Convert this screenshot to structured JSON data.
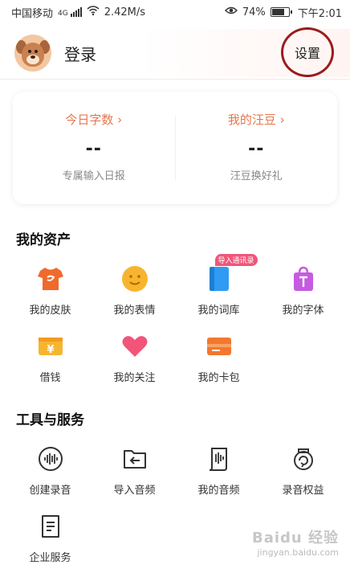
{
  "status_bar": {
    "carrier": "中国移动",
    "network": "4G",
    "speed": "2.42M/s",
    "battery": "74%",
    "time": "下午2:01"
  },
  "header": {
    "login": "登录",
    "settings": "设置"
  },
  "stats": [
    {
      "title": "今日字数 ›",
      "value": "--",
      "sub": "专属输入日报"
    },
    {
      "title": "我的汪豆 ›",
      "value": "--",
      "sub": "汪豆换好礼"
    }
  ],
  "assets": {
    "title": "我的资产",
    "items": [
      {
        "label": "我的皮肤",
        "icon": "shirt-icon"
      },
      {
        "label": "我的表情",
        "icon": "smiley-icon"
      },
      {
        "label": "我的词库",
        "icon": "book-icon",
        "badge": "导入通讯录"
      },
      {
        "label": "我的字体",
        "icon": "font-bag-icon"
      },
      {
        "label": "借钱",
        "icon": "yen-icon"
      },
      {
        "label": "我的关注",
        "icon": "heart-icon"
      },
      {
        "label": "我的卡包",
        "icon": "card-icon"
      }
    ]
  },
  "tools": {
    "title": "工具与服务",
    "items": [
      {
        "label": "创建录音",
        "icon": "waveform-icon"
      },
      {
        "label": "导入音频",
        "icon": "import-folder-icon"
      },
      {
        "label": "我的音频",
        "icon": "audio-document-icon"
      },
      {
        "label": "录音权益",
        "icon": "recording-rights-icon"
      },
      {
        "label": "企业服务",
        "icon": "enterprise-document-icon"
      }
    ]
  },
  "watermark": {
    "brand": "Baidu 经验",
    "url": "jingyan.baidu.com"
  },
  "colors": {
    "accent": "#e4774d",
    "settings_highlight": "#9b1c1c",
    "badge": "#f0567a"
  }
}
